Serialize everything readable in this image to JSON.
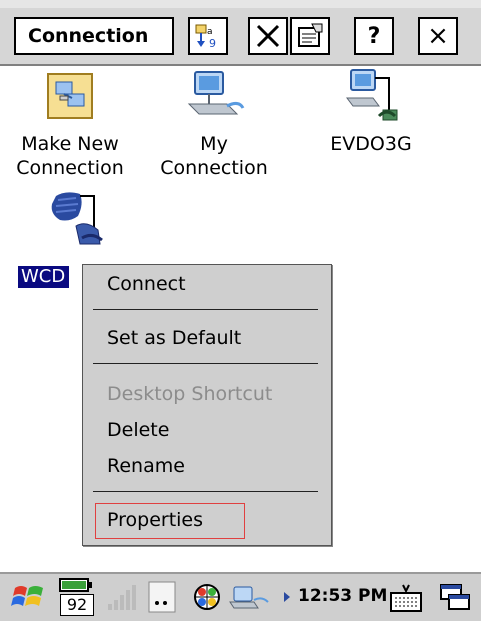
{
  "toolbar": {
    "title": "Connection",
    "buttons": {
      "sort": "sort-icon",
      "delete": "delete-icon",
      "properties": "properties-icon",
      "help": "?",
      "close": "×"
    }
  },
  "icons": [
    {
      "label_line1": "Make New",
      "label_line2": "Connection",
      "icon": "new-connection-icon"
    },
    {
      "label_line1": "My",
      "label_line2": "Connection",
      "icon": "network-computer-icon"
    },
    {
      "label_line1": "EVDO3G",
      "label_line2": "",
      "icon": "dialup-phone-icon"
    },
    {
      "label_line1": "WCD",
      "label_line2": "",
      "icon": "dialup-phone-icon"
    }
  ],
  "context_menu": {
    "items": [
      {
        "label": "Connect",
        "enabled": true
      },
      {
        "label": "Set as Default",
        "enabled": true
      },
      {
        "label": "Desktop Shortcut",
        "enabled": false
      },
      {
        "label": "Delete",
        "enabled": true
      },
      {
        "label": "Rename",
        "enabled": true
      },
      {
        "label": "Properties",
        "enabled": true
      }
    ]
  },
  "taskbar": {
    "battery": "92",
    "clock": "12:53 PM",
    "icons": [
      "start-flag-icon",
      "battery-icon",
      "signal-icon",
      "more-icon",
      "globe-icon",
      "network-icon",
      "keyboard-icon",
      "desktop-icon"
    ]
  },
  "colors": {
    "selection": "#0a0a80",
    "menu_bg": "#cfcfcf",
    "toolbar_bg": "#d6d6d6",
    "focus_border": "#e04040"
  }
}
